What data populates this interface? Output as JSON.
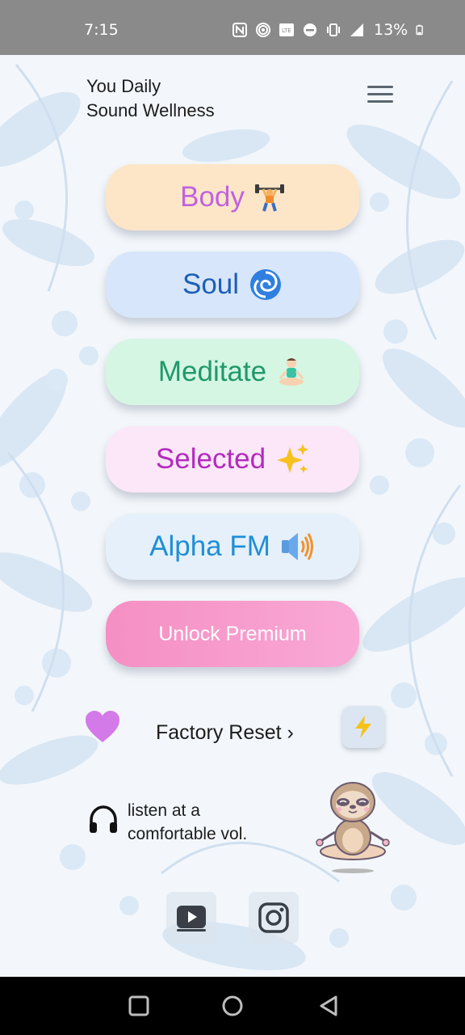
{
  "status_bar": {
    "time": "7:15",
    "battery": "13%"
  },
  "header": {
    "title_line1": "You Daily",
    "title_line2": "Sound Wellness"
  },
  "menu": {
    "items": [
      {
        "label": "Body",
        "emoji": "🏋️"
      },
      {
        "label": "Soul",
        "emoji": "🌀"
      },
      {
        "label": "Meditate",
        "emoji": "🧘"
      },
      {
        "label": "Selected",
        "emoji": "✨"
      },
      {
        "label": "Alpha FM",
        "emoji": "🔊"
      }
    ],
    "premium_label": "Unlock Premium"
  },
  "footer": {
    "factory_reset": "Factory Reset ›",
    "listen_line1": "listen at a",
    "listen_line2": "comfortable vol."
  },
  "icons": {
    "heart": "heart-icon",
    "bolt": "lightning-icon",
    "headphones": "headphones-icon",
    "youtube": "youtube-icon",
    "instagram": "instagram-icon"
  },
  "colors": {
    "body": "#fde6c8",
    "soul": "#d7e6fb",
    "meditate": "#d5f6e3",
    "selected": "#fbe7f7",
    "alpha": "#e5f0fa",
    "premium": "#f58fc3",
    "heart": "#d479e8"
  }
}
